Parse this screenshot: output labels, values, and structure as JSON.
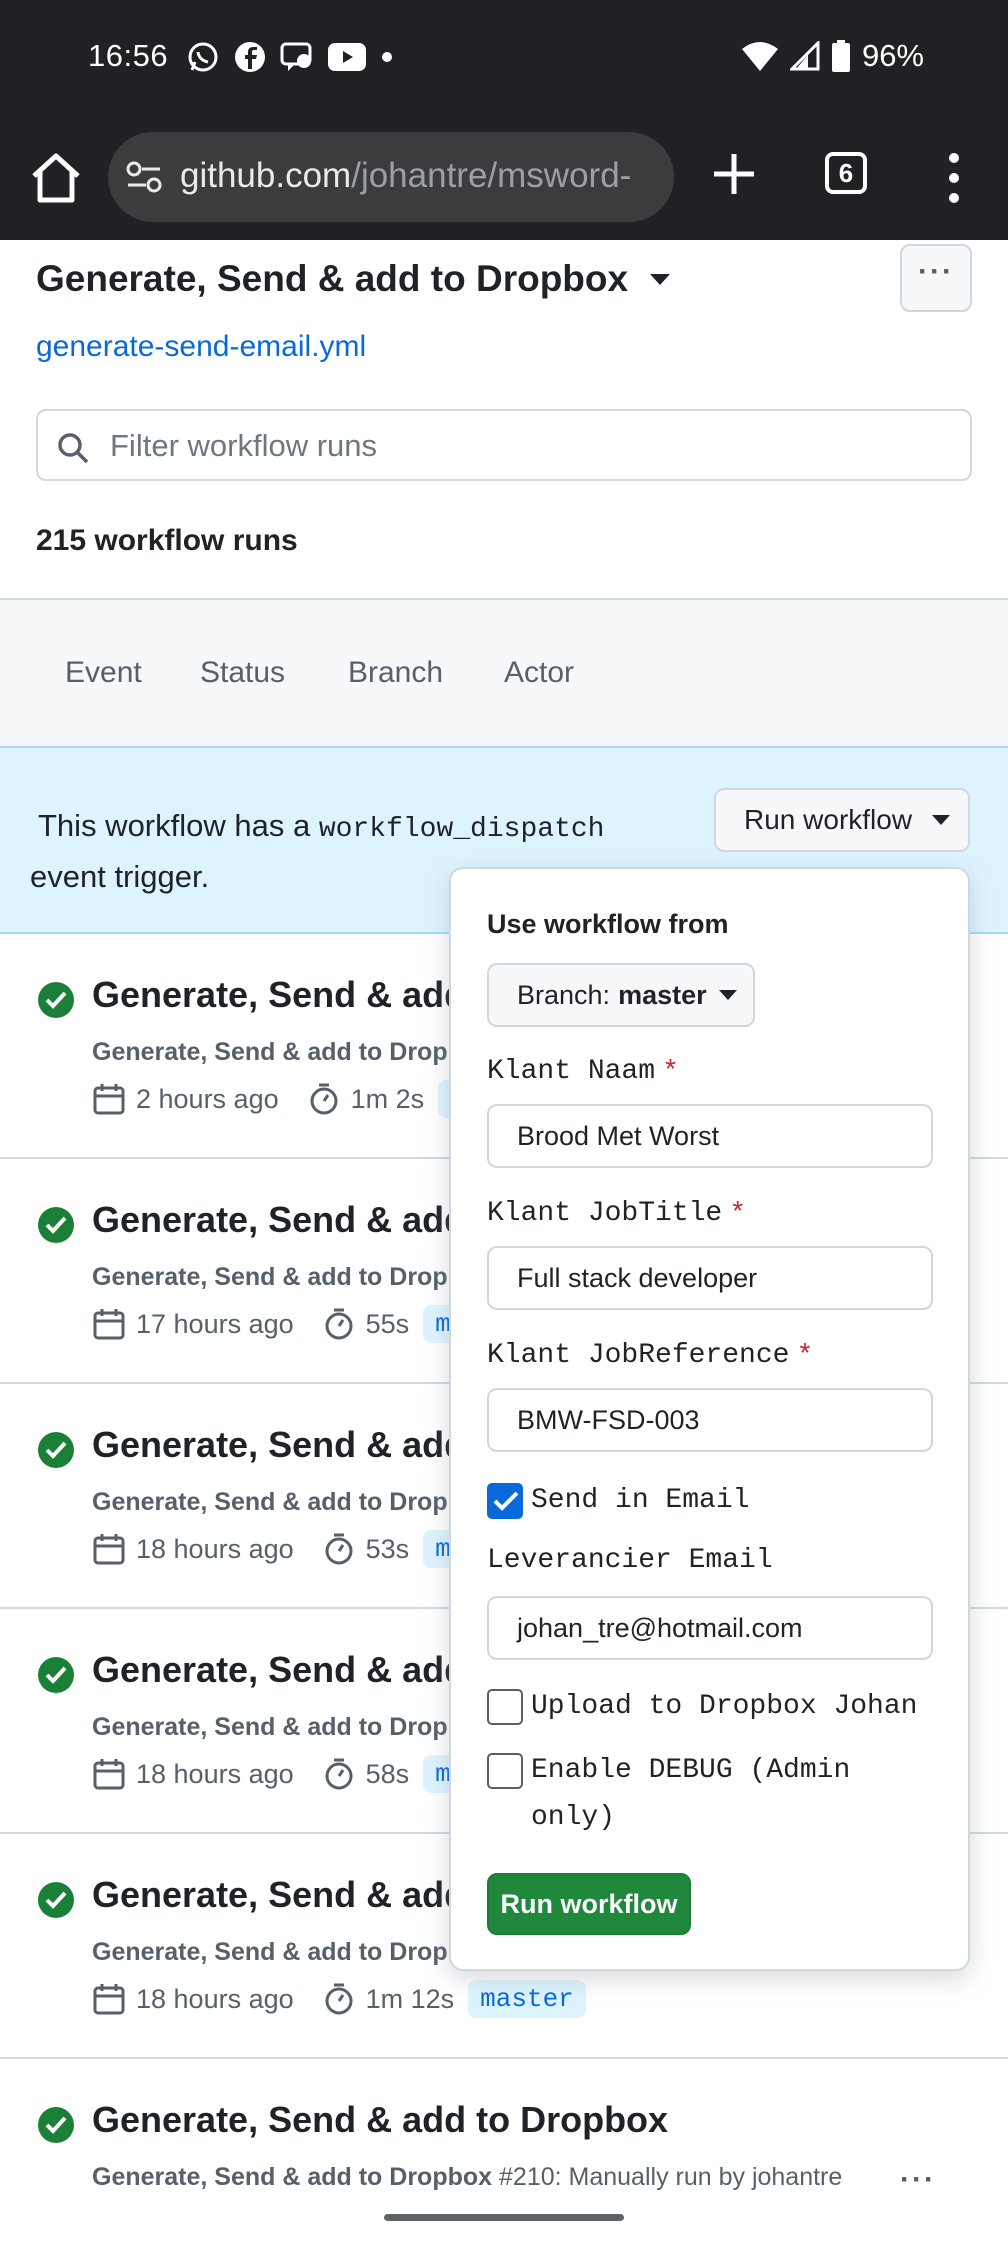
{
  "status_bar": {
    "time": "16:56",
    "battery": "96%",
    "icons": [
      "whatsapp-icon",
      "facebook-icon",
      "chat-bubble-icon",
      "youtube-icon",
      "dot-icon",
      "wifi-icon",
      "signal-icon",
      "battery-icon"
    ]
  },
  "browser": {
    "url_host": "github.com",
    "url_path": "/johantre/msword-",
    "tab_count": "6"
  },
  "workflow": {
    "title": "Generate, Send & add to Dropbox",
    "file": "generate-send-email.yml",
    "more_label": "···"
  },
  "filter": {
    "placeholder": "Filter workflow runs"
  },
  "runs_count": "215 workflow runs",
  "filter_tabs": [
    "Event",
    "Status",
    "Branch",
    "Actor"
  ],
  "dispatch": {
    "text_before": "This workflow has a ",
    "code": "workflow_dispatch",
    "text_after": " event trigger.",
    "button_label": "Run workflow"
  },
  "runs": [
    {
      "title": "Generate, Send & add",
      "subtitle": "Generate, Send & add to Drop",
      "time": "2 hours ago",
      "duration": "1m 2s",
      "branch": "m"
    },
    {
      "title": "Generate, Send & add",
      "subtitle": "Generate, Send & add to Drop",
      "time": "17 hours ago",
      "duration": "55s",
      "branch": "ma"
    },
    {
      "title": "Generate, Send & add",
      "subtitle": "Generate, Send & add to Drop",
      "time": "18 hours ago",
      "duration": "53s",
      "branch": "ma"
    },
    {
      "title": "Generate, Send & add",
      "subtitle": "Generate, Send & add to Drop",
      "time": "18 hours ago",
      "duration": "58s",
      "branch": "ma"
    },
    {
      "title": "Generate, Send & add",
      "subtitle": "Generate, Send & add to Drop",
      "time": "18 hours ago",
      "duration": "1m 12s",
      "branch": "master"
    },
    {
      "title": "Generate, Send & add to Dropbox",
      "subtitle_bold": "Generate, Send & add to Dropbox",
      "subtitle": " #210: Manually run by johantre",
      "more": "···"
    }
  ],
  "popup": {
    "heading": "Use workflow from",
    "branch_prefix": "Branch:",
    "branch_value": "master",
    "fields": [
      {
        "label": "Klant Naam",
        "required": "*",
        "value": "Brood Met Worst"
      },
      {
        "label": "Klant JobTitle",
        "required": "*",
        "value": "Full stack developer"
      },
      {
        "label": "Klant JobReference",
        "required": "*",
        "value": "BMW-FSD-003"
      }
    ],
    "send_email": {
      "label": "Send in Email",
      "checked": true
    },
    "leverancier": {
      "label": "Leverancier Email",
      "value": "johan_tre@hotmail.com"
    },
    "upload_dropbox": {
      "label": "Upload to Dropbox Johan",
      "checked": false
    },
    "debug": {
      "label_line1": "Enable DEBUG (Admin",
      "label_line2": "only)",
      "checked": false
    },
    "run_button": "Run workflow"
  },
  "colors": {
    "success": "#1a7f37",
    "link": "#0969da",
    "primary_button": "#1f883d",
    "dispatch_bg": "#ddf4ff",
    "required": "#cf222e"
  }
}
